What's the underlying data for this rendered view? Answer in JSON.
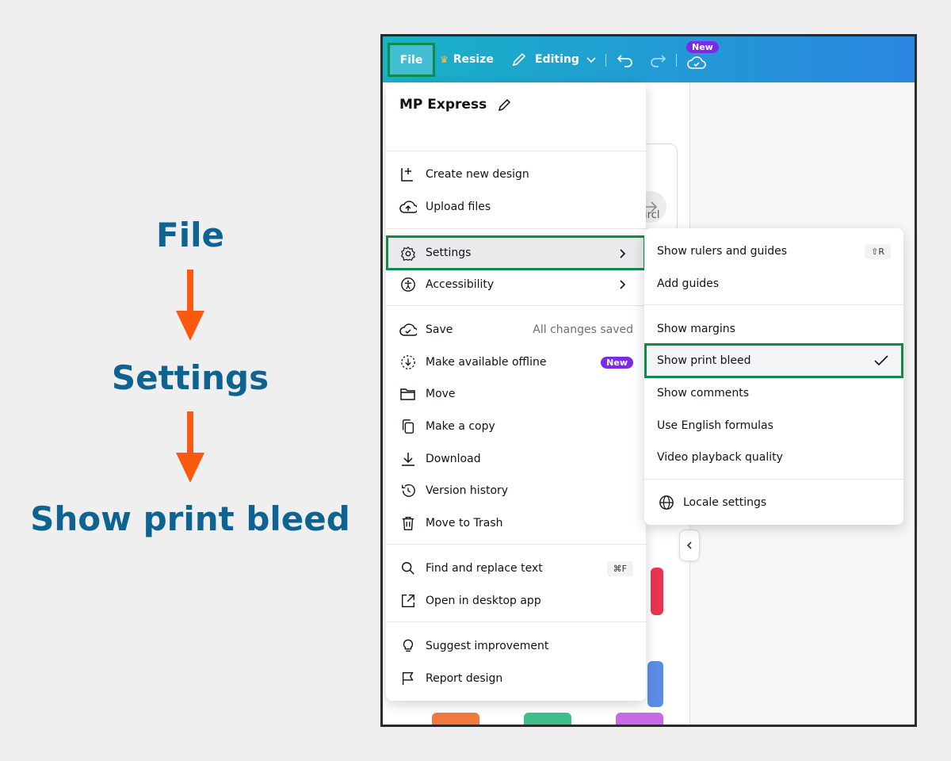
{
  "steps": {
    "step1": "File",
    "step2": "Settings",
    "step3": "Show print bleed"
  },
  "colors": {
    "step_text": "#0e6391",
    "arrow": "#fa5a0f",
    "highlight_border": "#138a4a",
    "badge": "#7d2ae8"
  },
  "toolbar": {
    "file_label": "File",
    "resize_label": "Resize",
    "editing_label": "Editing",
    "new_badge": "New"
  },
  "background": {
    "partial_text": "ircl"
  },
  "file_menu": {
    "title": "MP Express",
    "items": {
      "create_new": "Create new design",
      "upload": "Upload files",
      "settings": "Settings",
      "accessibility": "Accessibility",
      "save": "Save",
      "save_status": "All changes saved",
      "offline": "Make available offline",
      "offline_badge": "New",
      "move": "Move",
      "copy": "Make a copy",
      "download": "Download",
      "version": "Version history",
      "trash": "Move to Trash",
      "find": "Find and replace text",
      "find_shortcut": "⌘F",
      "desktop": "Open in desktop app",
      "suggest": "Suggest improvement",
      "report": "Report design"
    }
  },
  "settings_menu": {
    "rulers": "Show rulers and guides",
    "rulers_shortcut": "⇧R",
    "add_guides": "Add guides",
    "margins": "Show margins",
    "print_bleed": "Show print bleed",
    "comments": "Show comments",
    "english_formulas": "Use English formulas",
    "video_quality": "Video playback quality",
    "locale": "Locale settings"
  }
}
